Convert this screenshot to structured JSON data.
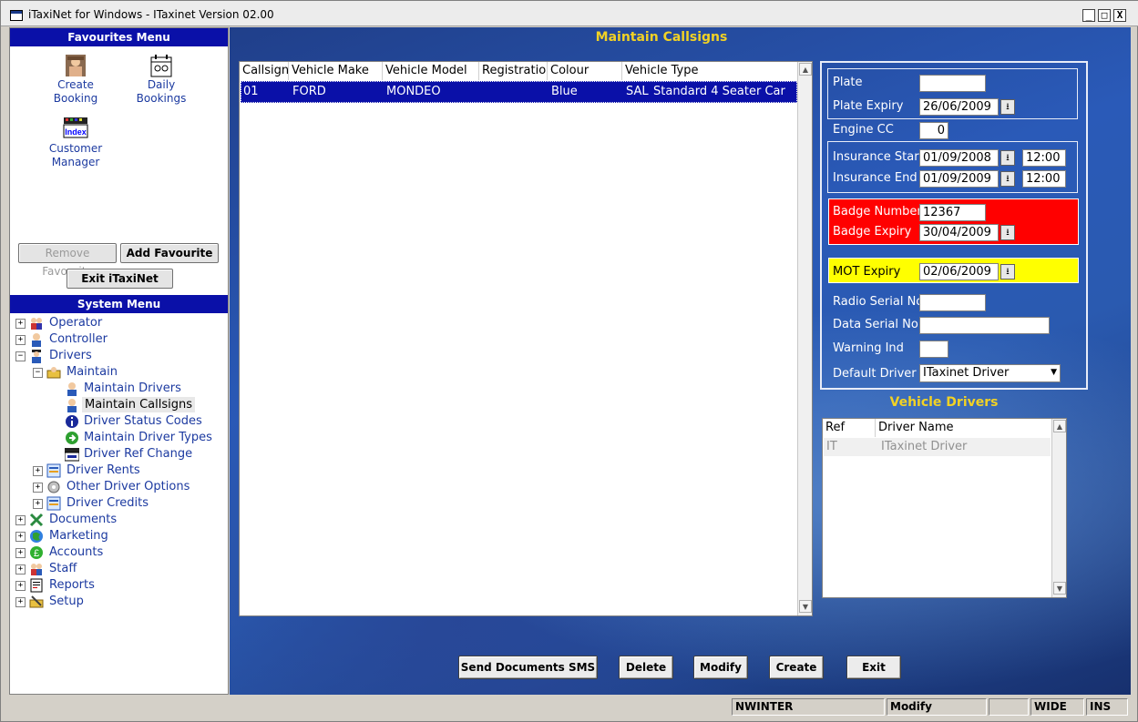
{
  "window": {
    "title": "iTaxiNet for Windows - ITaxinet Version 02.00",
    "minimize": "_",
    "maximize": "□",
    "close": "X"
  },
  "favourites": {
    "header": "Favourites Menu",
    "items": [
      {
        "label1": "Create",
        "label2": "Booking",
        "icon": "create-booking-icon"
      },
      {
        "label1": "Daily",
        "label2": "Bookings",
        "icon": "daily-bookings-icon"
      },
      {
        "label1": "Customer",
        "label2": "Manager",
        "icon": "customer-manager-icon"
      }
    ],
    "index_icon_text": "Index",
    "remove_label": "Remove Favourite",
    "add_label": "Add Favourite",
    "exit_label": "Exit iTaxiNet"
  },
  "system_menu": {
    "header": "System Menu",
    "items": [
      {
        "label": "Operator",
        "expander": "+",
        "icon": "operator-icon"
      },
      {
        "label": "Controller",
        "expander": "+",
        "icon": "controller-icon"
      },
      {
        "label": "Drivers",
        "expander": "−",
        "icon": "drivers-icon"
      },
      {
        "label": "Maintain",
        "expander": "−",
        "icon": "maintain-icon"
      },
      {
        "label": "Maintain Drivers",
        "icon": "maintain-drivers-icon"
      },
      {
        "label": "Maintain Callsigns",
        "icon": "maintain-callsigns-icon"
      },
      {
        "label": "Driver Status Codes",
        "icon": "info-icon"
      },
      {
        "label": "Maintain Driver Types",
        "icon": "driver-types-icon"
      },
      {
        "label": "Driver Ref Change",
        "icon": "index-icon"
      },
      {
        "label": "Driver Rents",
        "expander": "+",
        "icon": "driver-rents-icon"
      },
      {
        "label": "Other Driver Options",
        "expander": "+",
        "icon": "other-options-icon"
      },
      {
        "label": "Driver Credits",
        "expander": "+",
        "icon": "driver-credits-icon"
      },
      {
        "label": "Documents",
        "expander": "+",
        "icon": "documents-icon"
      },
      {
        "label": "Marketing",
        "expander": "+",
        "icon": "marketing-icon"
      },
      {
        "label": "Accounts",
        "expander": "+",
        "icon": "accounts-icon"
      },
      {
        "label": "Staff",
        "expander": "+",
        "icon": "staff-icon"
      },
      {
        "label": "Reports",
        "expander": "+",
        "icon": "reports-icon"
      },
      {
        "label": "Setup",
        "expander": "+",
        "icon": "setup-icon"
      }
    ]
  },
  "main": {
    "title": "Maintain Callsigns",
    "grid": {
      "columns": [
        "Callsign",
        "Vehicle Make",
        "Vehicle Model",
        "Registration",
        "Colour",
        "Vehicle Type"
      ],
      "rows": [
        {
          "callsign": "01",
          "make": "FORD",
          "model": "MONDEO",
          "registration": "",
          "colour": "Blue",
          "type_code": "SAL",
          "type": "Standard 4 Seater Car"
        }
      ]
    },
    "scroll_up": "▲",
    "scroll_down": "▼"
  },
  "details": {
    "plate_label": "Plate",
    "plate_value": "",
    "plate_expiry_label": "Plate Expiry",
    "plate_expiry_value": "26/06/2009",
    "engine_cc_label": "Engine CC",
    "engine_cc_value": "0",
    "insurance_start_label": "Insurance Start",
    "insurance_start_date": "01/09/2008",
    "insurance_start_time": "12:00",
    "insurance_end_label": "Insurance End",
    "insurance_end_date": "01/09/2009",
    "insurance_end_time": "12:00",
    "badge_number_label": "Badge Number",
    "badge_number_value": "12367",
    "badge_expiry_label": "Badge Expiry",
    "badge_expiry_value": "30/04/2009",
    "mot_expiry_label": "MOT Expiry",
    "mot_expiry_value": "02/06/2009",
    "radio_serial_label": "Radio Serial No",
    "radio_serial_value": "",
    "data_serial_label": "Data Serial No",
    "data_serial_value": "",
    "warning_ind_label": "Warning Ind",
    "warning_ind_value": "",
    "default_driver_label": "Default Driver",
    "default_driver_value": "ITaxinet Driver",
    "date_button": "⭳",
    "select_arrow": "▼"
  },
  "vehicle_drivers": {
    "title": "Vehicle Drivers",
    "columns": [
      "Ref",
      "Driver Name"
    ],
    "rows": [
      {
        "ref": "IT",
        "name": "ITaxinet Driver"
      }
    ]
  },
  "buttons": {
    "send_sms": "Send Documents SMS",
    "delete": "Delete",
    "modify": "Modify",
    "create": "Create",
    "exit": "Exit"
  },
  "statusbar": {
    "user": "NWINTER",
    "mode": "Modify",
    "blank": "",
    "wide": "WIDE",
    "ins": "INS"
  },
  "colors": {
    "header_blue": "#0a10a8",
    "gold": "#f2d224",
    "badge_red": "#ff0000",
    "mot_yellow": "#ffff00"
  }
}
